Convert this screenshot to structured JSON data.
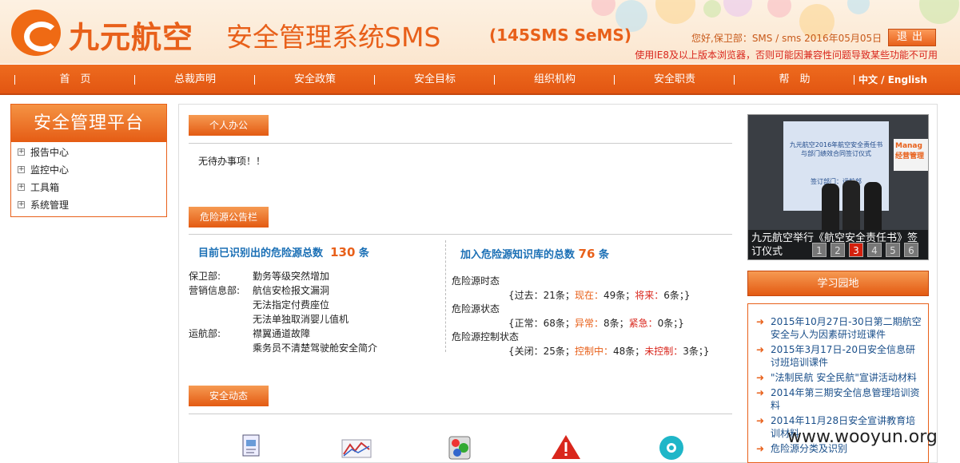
{
  "header": {
    "logo_text": "九元航空",
    "system_title": "安全管理系统SMS",
    "system_subtitle": "(145SMS SeMS)",
    "user_info": "您好,保卫部：SMS / sms 2016年05月05日",
    "logout_label": "退出",
    "browser_notice": "使用IE8及以上版本浏览器，否则可能因兼容性问题导致某些功能不可用"
  },
  "nav": {
    "items": [
      "首　页",
      "总裁声明",
      "安全政策",
      "安全目标",
      "组织机构",
      "安全职责",
      "帮　助"
    ],
    "lang": "中文 / English"
  },
  "sidebar": {
    "title": "安全管理平台",
    "items": [
      "报告中心",
      "监控中心",
      "工具箱",
      "系统管理"
    ]
  },
  "main": {
    "personal_tab": "个人办公",
    "todo_text": "无待办事项！！",
    "hazard_tab": "危险源公告栏",
    "identified_label": "目前已识别出的危险源总数",
    "identified_count": "130",
    "identified_unit": "条",
    "kb_label": "加入危险源知识库的总数",
    "kb_count": "76",
    "kb_unit": "条",
    "departments": [
      {
        "name": "保卫部:",
        "items": [
          "勤务等级突然增加"
        ]
      },
      {
        "name": "营销信息部:",
        "items": [
          "航信安检报文漏洞",
          "无法指定付费座位",
          "无法单独取消婴儿值机"
        ]
      },
      {
        "name": "运航部:",
        "items": [
          "襟翼通道故障",
          "乘务员不清楚驾驶舱安全简介"
        ]
      }
    ],
    "stats": {
      "time_label": "危险源时态",
      "time_values": {
        "past_label": "过去：",
        "past": "21条；",
        "now_label": "现在：",
        "now": "49条；",
        "future_label": "将来：",
        "future": "6条；"
      },
      "state_label": "危险源状态",
      "state_values": {
        "normal_label": "正常：",
        "normal": "68条；",
        "abnormal_label": "异常：",
        "abnormal": "8条；",
        "urgent_label": "紧急：",
        "urgent": "0条；"
      },
      "control_label": "危险源控制状态",
      "control_values": {
        "closed_label": "关闭：",
        "closed": "25条；",
        "controlling_label": "控制中：",
        "controlling": "48条；",
        "uncontrolled_label": "未控制：",
        "uncontrolled": "3条；"
      }
    },
    "safety_tab": "安全动态"
  },
  "news": {
    "caption": "九元航空举行《航空安全责任书》签订仪式",
    "pages": [
      "1",
      "2",
      "3",
      "4",
      "5",
      "6"
    ],
    "active_page": "3",
    "screen_title": "九元航空2016年航空安全责任书与部门绩效合同签订仪式",
    "screen_sub": "签订部门：运航部",
    "banner_text": "Manag 经营管理"
  },
  "study": {
    "title": "学习园地",
    "items": [
      "2015年10月27日-30日第二期航空安全与人为因素研讨班课件",
      "2015年3月17日-20日安全信息研讨班培训课件",
      "\"法制民航 安全民航\"宣讲活动材料",
      "2014年第三期安全信息管理培训资料",
      "2014年11月28日安全宣讲教育培训材料",
      "危险源分类及识别"
    ]
  },
  "watermark": "www.wooyun.org",
  "colors": {
    "brand_orange": "#e8601a",
    "link_blue": "#1a6fb5",
    "alert_red": "#d9261c"
  }
}
